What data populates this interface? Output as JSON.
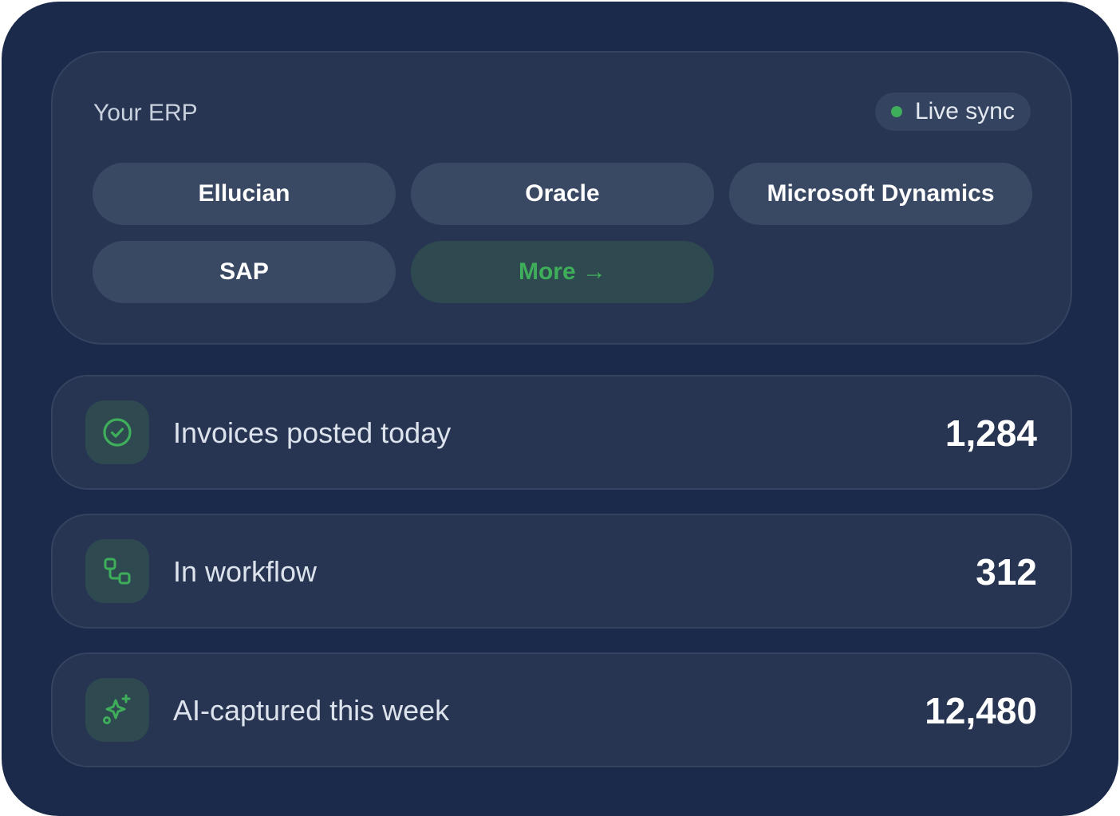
{
  "erp": {
    "label": "Your ERP",
    "live_sync": "Live sync",
    "options": [
      "Ellucian",
      "Oracle",
      "Microsoft Dynamics",
      "SAP"
    ],
    "more_label": "More →"
  },
  "stats": [
    {
      "label": "Invoices posted today",
      "value": "1,284",
      "icon": "check-circle-icon"
    },
    {
      "label": "In workflow",
      "value": "312",
      "icon": "workflow-icon"
    },
    {
      "label": "AI-captured this week",
      "value": "12,480",
      "icon": "sparkle-icon"
    }
  ],
  "colors": {
    "background": "#1b2a4a",
    "card": "#273552",
    "accent_green": "#3fae5a",
    "live_dot": "#3fae5a"
  }
}
